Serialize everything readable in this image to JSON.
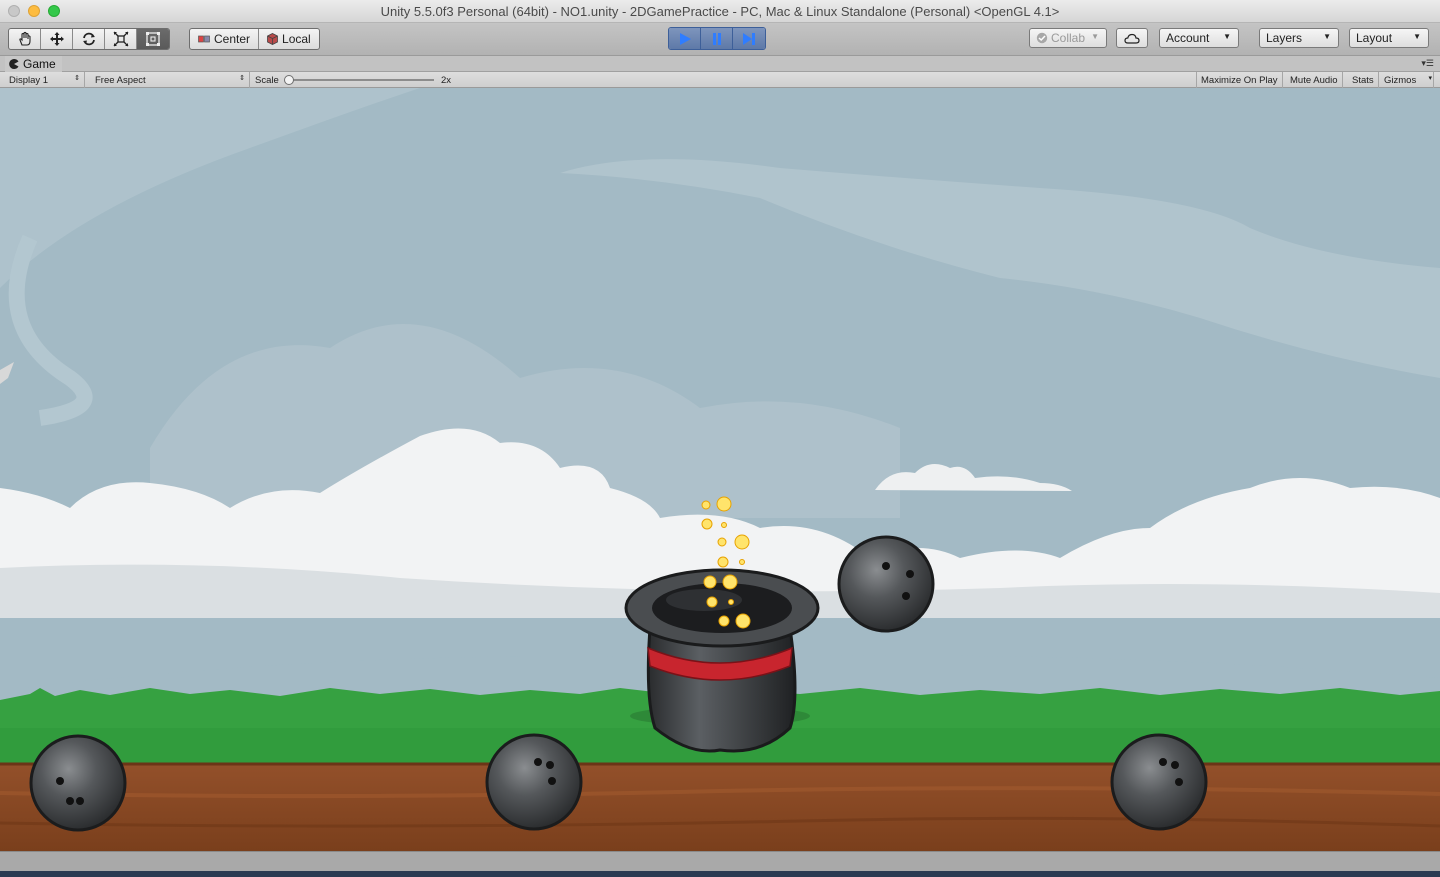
{
  "window": {
    "title": "Unity 5.5.0f3 Personal (64bit) - NO1.unity - 2DGamePractice - PC, Mac & Linux Standalone (Personal) <OpenGL 4.1>"
  },
  "toolbar": {
    "transform_tools": [
      "hand-tool-icon",
      "move-tool-icon",
      "rotate-tool-icon",
      "scale-tool-icon",
      "rect-tool-icon"
    ],
    "pivot_mode": "Center",
    "pivot_rotation": "Local",
    "collab_label": "Collab",
    "account_label": "Account",
    "layers_label": "Layers",
    "layout_label": "Layout"
  },
  "game_view": {
    "tab_label": "Game",
    "display": "Display 1",
    "aspect": "Free Aspect",
    "scale_label": "Scale",
    "scale_value": "2x",
    "maximize_on_play": "Maximize On Play",
    "mute_audio": "Mute Audio",
    "stats": "Stats",
    "gizmos": "Gizmos"
  },
  "colors": {
    "sky": "#a3bac5",
    "cloud": "#f2f3f4",
    "grass": "#36a141",
    "dirt": "#8c4a22",
    "play_active": "#2f7dff"
  }
}
